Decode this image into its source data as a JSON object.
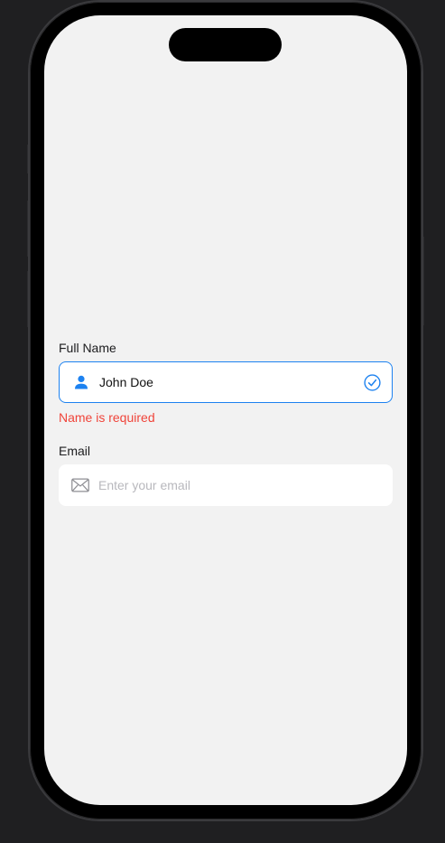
{
  "form": {
    "name_field": {
      "label": "Full Name",
      "value": "John Doe",
      "lead_icon": "person-icon",
      "trail_icon": "checkmark-circle-icon",
      "error": "Name is required",
      "state": "focused"
    },
    "email_field": {
      "label": "Email",
      "value": "",
      "placeholder": "Enter your email",
      "lead_icon": "envelope-icon"
    }
  },
  "colors": {
    "accent": "#1d82f0",
    "error": "#f0443a",
    "screen_background": "#f2f2f2",
    "field_background": "#ffffff",
    "placeholder": "#b8b8bd"
  }
}
